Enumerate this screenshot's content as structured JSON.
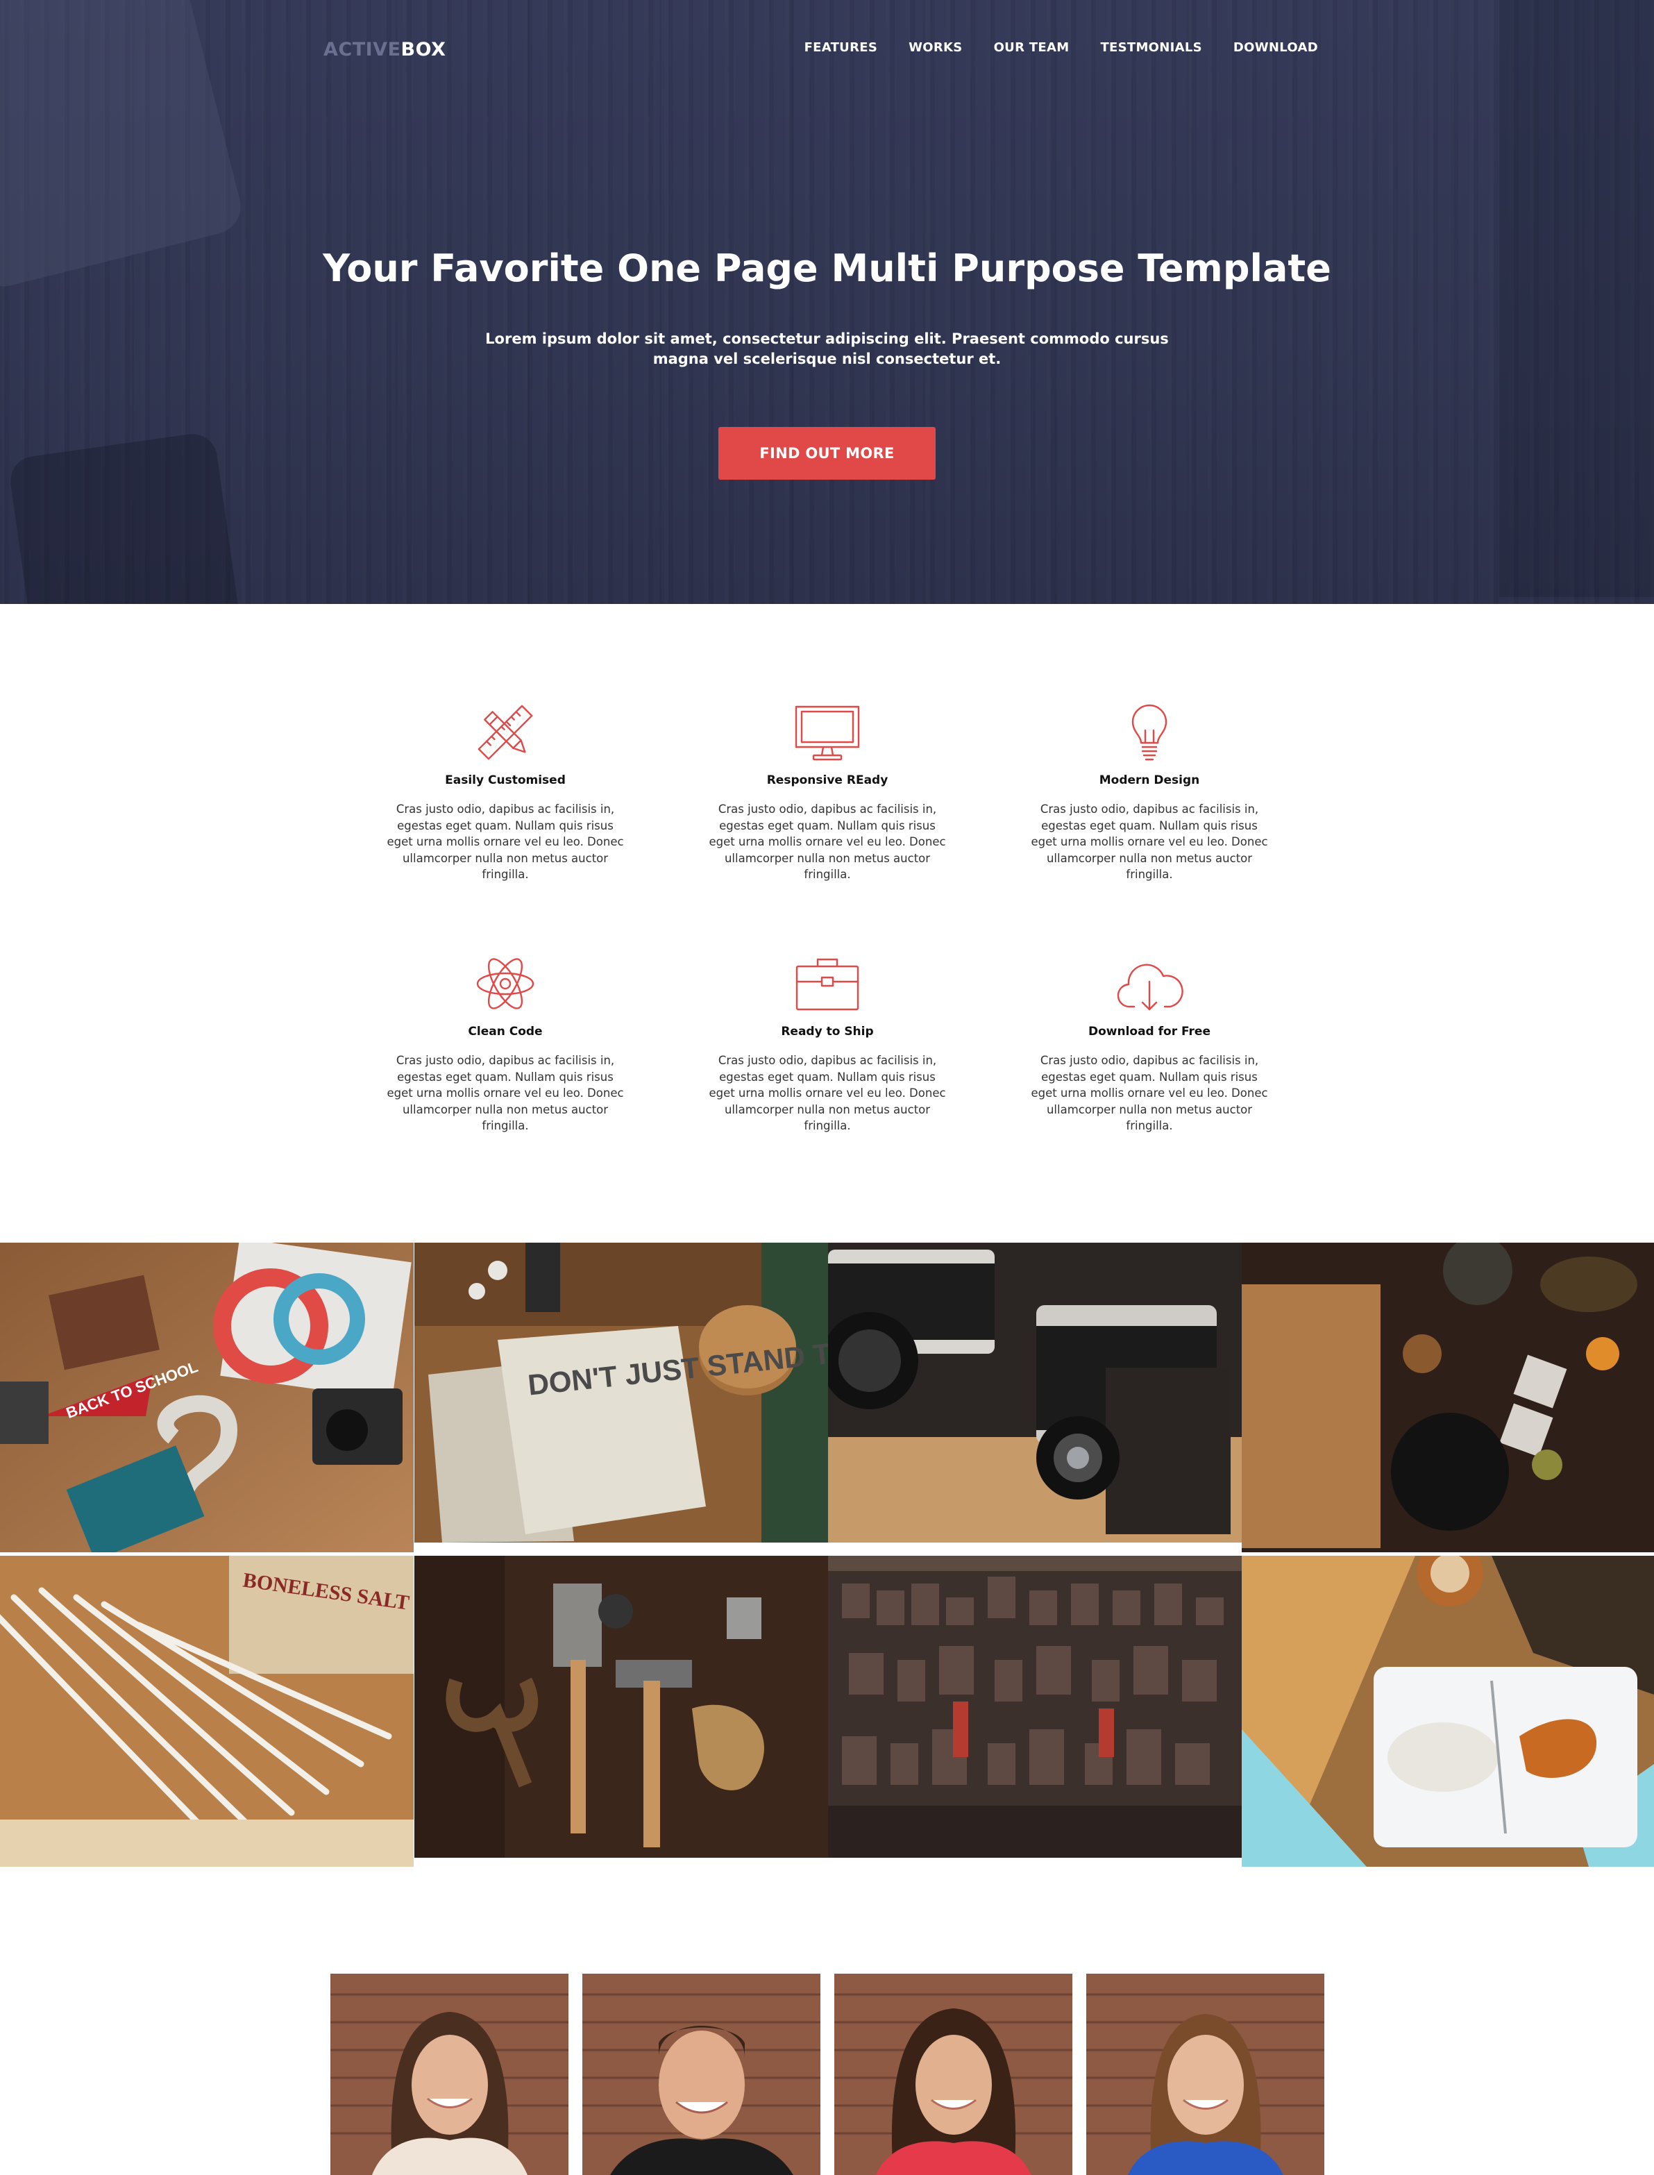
{
  "brand": {
    "logo_light": "ACTIVE",
    "logo_bold": "BOX"
  },
  "nav": {
    "items": [
      {
        "label": "FEATURES"
      },
      {
        "label": "WORKS"
      },
      {
        "label": "OUR TEAM"
      },
      {
        "label": "TESTMONIALS"
      },
      {
        "label": "DOWNLOAD"
      }
    ]
  },
  "hero": {
    "title": "Your Favorite One Page Multi Purpose Template",
    "subtitle": "Lorem ipsum dolor sit amet, consectetur adipiscing elit. Praesent commodo cursus magna vel scelerisque nisl consectetur et.",
    "button_label": "FIND OUT MORE"
  },
  "features": [
    {
      "icon": "pencil-ruler-icon",
      "title": "Easily Customised",
      "text": "Cras justo odio, dapibus ac facilisis in, egestas eget quam. Nullam quis risus eget urna mollis ornare vel eu leo. Donec ullamcorper nulla non metus auctor fringilla."
    },
    {
      "icon": "monitor-icon",
      "title": "Responsive REady",
      "text": "Cras justo odio, dapibus ac facilisis in, egestas eget quam. Nullam quis risus eget urna mollis ornare vel eu leo. Donec ullamcorper nulla non metus auctor fringilla."
    },
    {
      "icon": "lightbulb-icon",
      "title": "Modern Design",
      "text": "Cras justo odio, dapibus ac facilisis in, egestas eget quam. Nullam quis risus eget urna mollis ornare vel eu leo. Donec ullamcorper nulla non metus auctor fringilla."
    },
    {
      "icon": "atom-icon",
      "title": "Clean Code",
      "text": "Cras justo odio, dapibus ac facilisis in, egestas eget quam. Nullam quis risus eget urna mollis ornare vel eu leo. Donec ullamcorper nulla non metus auctor fringilla."
    },
    {
      "icon": "briefcase-icon",
      "title": "Ready to Ship",
      "text": "Cras justo odio, dapibus ac facilisis in, egestas eget quam. Nullam quis risus eget urna mollis ornare vel eu leo. Donec ullamcorper nulla non metus auctor fringilla."
    },
    {
      "icon": "cloud-download-icon",
      "title": "Download for Free",
      "text": "Cras justo odio, dapibus ac facilisis in, egestas eget quam. Nullam quis risus eget urna mollis ornare vel eu leo. Donec ullamcorper nulla non metus auctor fringilla."
    }
  ],
  "gallery": {
    "photo_text": {
      "pennant": "BACK TO SCHOOL",
      "notebook": "DON'T JUST STAND THERE",
      "sign": "BONELESS SALT CODFISH"
    }
  },
  "colors": {
    "accent": "#e14848",
    "hero_bg": "#2f3450",
    "logo_muted": "#6c7090",
    "text_dark": "#111111"
  }
}
